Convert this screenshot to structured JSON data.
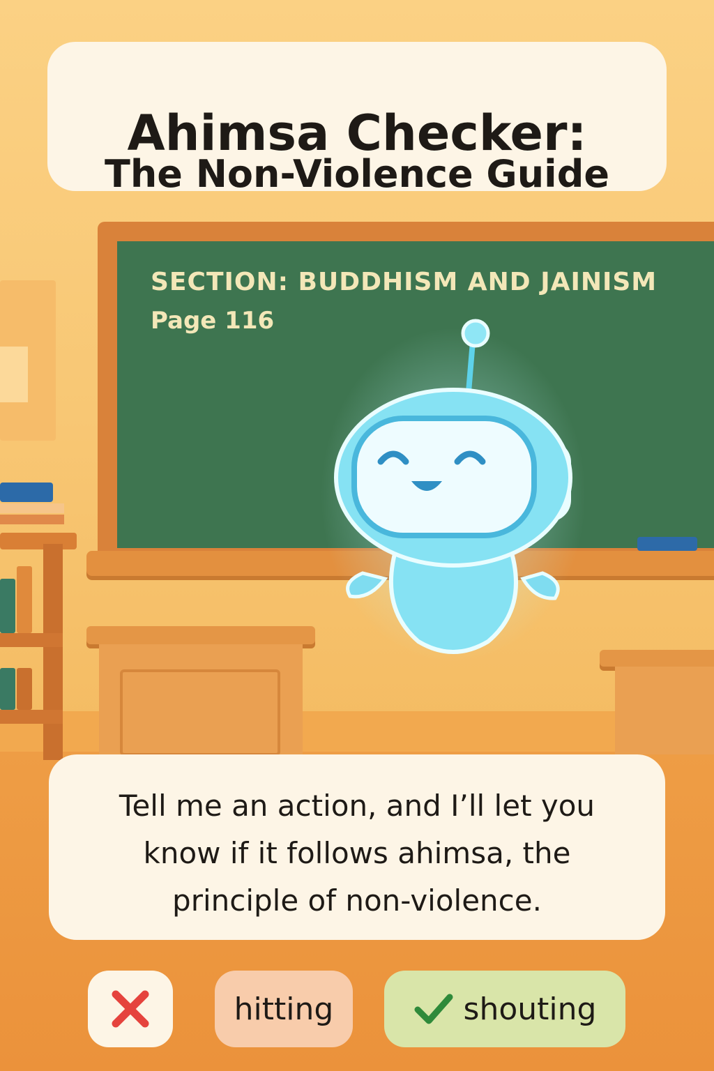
{
  "title": {
    "line1": "Ahimsa Checker:",
    "line2": "The Non-Violence Guide"
  },
  "chalkboard": {
    "section": "SECTION: BUDDHISM AND JAINISM",
    "page": "Page 116"
  },
  "assistant": {
    "icon": "robot-mascot-icon",
    "message": "Tell me an action, and I’ll let you know if it follows ahimsa, the principle of non-violence."
  },
  "choices": [
    {
      "icon": "cross-icon",
      "label": "",
      "color": "#e5433d"
    },
    {
      "label": "hitting",
      "color": "#f8ccab"
    },
    {
      "icon": "checkmark-icon",
      "label": "shouting",
      "color": "#d9e5a9",
      "check_color": "#2f8a3a"
    }
  ],
  "colors": {
    "wall": "#f8c774",
    "chalkboard": "#3e7550",
    "card": "#fdf5e6",
    "robot": "#7fe0f2"
  }
}
